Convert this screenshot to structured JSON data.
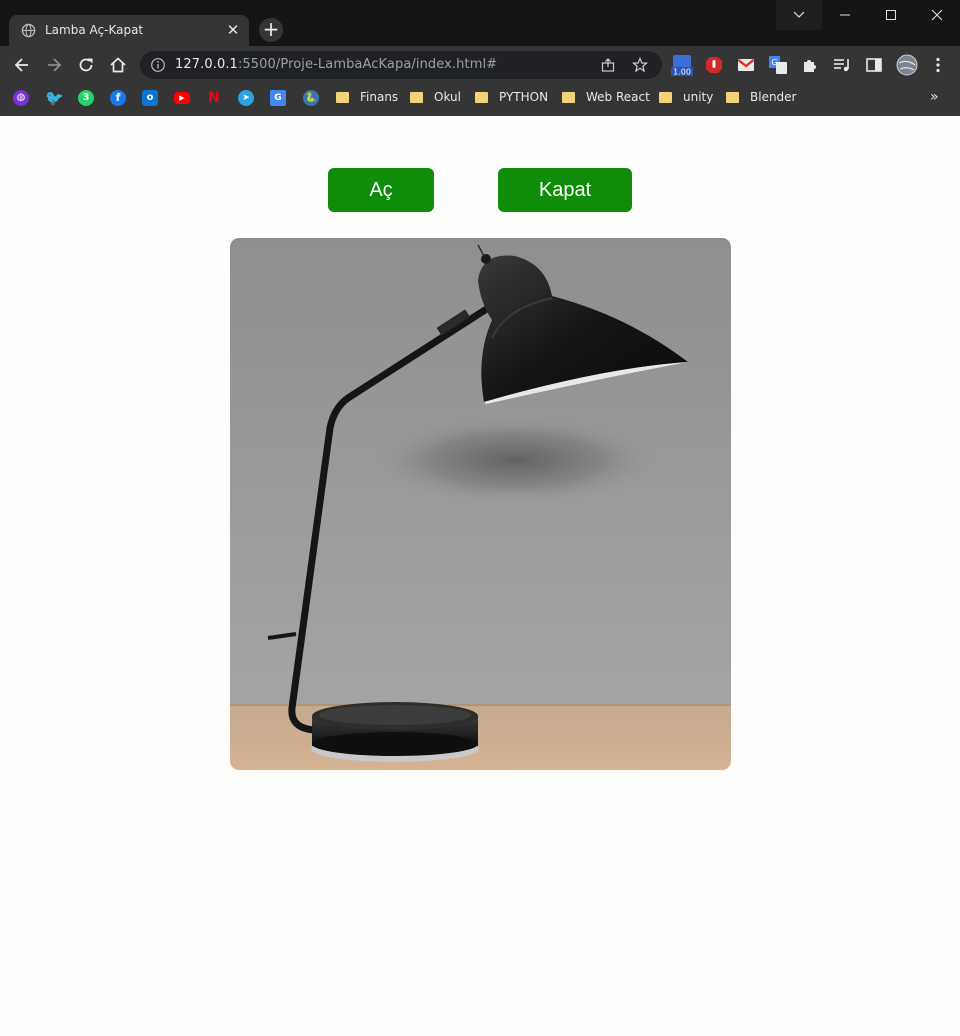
{
  "browser": {
    "tab_title": "Lamba Aç-Kapat",
    "tab_close": "✕",
    "new_tab": "+",
    "url_host": "127.0.0.1",
    "url_rest": ":5500/Proje-LambaAcKapa/index.html#",
    "extension_badge": "1.00",
    "whatsapp_badge": "3",
    "bookmarks_more": "»",
    "bookmark_folders": [
      "Finans",
      "Okul",
      "PYTHON",
      "Web React",
      "unity",
      "Blender"
    ]
  },
  "page": {
    "on_button": "Aç",
    "off_button": "Kapat",
    "lamp_image_alt": "masa lambası"
  },
  "colors": {
    "button_bg": "#0f8c0a",
    "button_text": "#ffffff",
    "page_bg": "#fdfdfc"
  }
}
